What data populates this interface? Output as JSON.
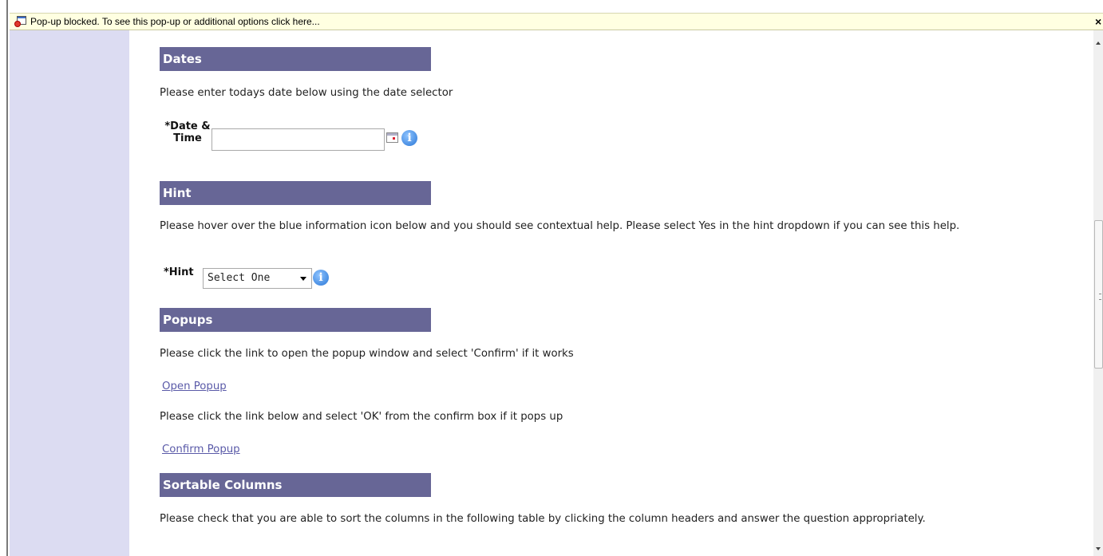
{
  "browser": {
    "infobar_text": "Pop-up blocked. To see this pop-up or additional options click here...",
    "close_glyph": "×"
  },
  "sections": {
    "dates": {
      "title": "Dates",
      "instruction": "Please enter todays date below using the date selector",
      "field_label": "*Date & Time",
      "field_value": ""
    },
    "hint": {
      "title": "Hint",
      "instruction": "Please hover over the blue information icon below and you should see contextual help. Please select Yes in the hint dropdown if you can see this help.",
      "field_label": "*Hint",
      "selected": "Select One"
    },
    "popups": {
      "title": "Popups",
      "instruction1": "Please click the link to open the popup window and select 'Confirm' if it works",
      "link1": "Open Popup",
      "instruction2": "Please click the link below and select 'OK' from the confirm box if it pops up",
      "link2": "Confirm Popup"
    },
    "sortable": {
      "title": "Sortable Columns",
      "instruction": "Please check that you are able to sort the columns in the following table by clicking the column headers and answer the question appropriately."
    }
  },
  "icons": {
    "info_glyph": "i"
  },
  "colors": {
    "section_header_bg": "#676696",
    "sidebar_bg": "#dcdcf2",
    "infobar_bg": "#ffffe1",
    "link": "#5a5aa8"
  }
}
